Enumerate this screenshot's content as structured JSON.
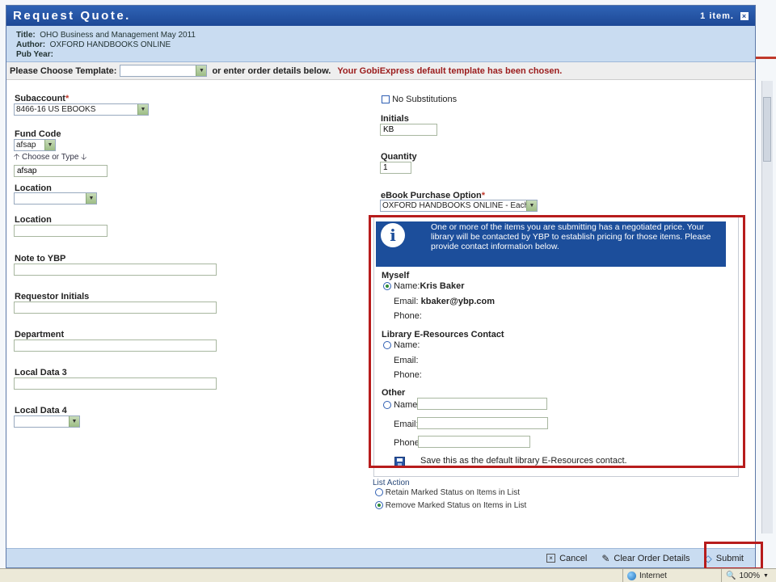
{
  "dialog": {
    "title": "Request Quote.",
    "item_count": "1 item.",
    "close_glyph": "×"
  },
  "info": {
    "title_label": "Title:",
    "title_value": "OHO Business and Management May 2011",
    "author_label": "Author:",
    "author_value": "OXFORD HANDBOOKS ONLINE",
    "pubyear_label": "Pub Year:"
  },
  "template": {
    "label": "Please Choose Template:",
    "selected": "",
    "or_text": "or enter order details below.",
    "message": "Your GobiExpress default template has been chosen."
  },
  "left": {
    "subaccount_label": "Subaccount",
    "subaccount_value": "8466-16 US EBOOKS",
    "fund_code_label": "Fund Code",
    "fund_code_select": "afsap",
    "choose_or_type": "Choose or Type",
    "fund_code_input": "afsap",
    "location1_label": "Location",
    "location1_value": "",
    "location2_label": "Location",
    "location2_value": "",
    "note_label": "Note to YBP",
    "requestor_label": "Requestor Initials",
    "department_label": "Department",
    "local3_label": "Local Data 3",
    "local4_label": "Local Data 4",
    "local4_value": ""
  },
  "right": {
    "no_subs_label": "No Substitutions",
    "initials_label": "Initials",
    "initials_value": "KB",
    "quantity_label": "Quantity",
    "quantity_value": "1",
    "ebook_label": "eBook Purchase Option",
    "ebook_value": "OXFORD HANDBOOKS ONLINE - Each"
  },
  "contact": {
    "notice": "One or more of the items you are submitting has a negotiated price. Your library will be contacted by YBP to establish pricing for those items. Please provide contact information below.",
    "notice_icon": "i",
    "myself_heading": "Myself",
    "name_label": "Name:",
    "myself_name": "Kris Baker",
    "email_label": "Email:",
    "myself_email": "kbaker@ybp.com",
    "phone_label": "Phone:",
    "library_heading": "Library E-Resources Contact",
    "other_heading": "Other",
    "other_phone_label": "Phone",
    "save_default": "Save this as the default library E-Resources contact."
  },
  "list_action": {
    "label": "List Action",
    "retain": "Retain Marked Status on Items in List",
    "remove": "Remove Marked Status on Items in List"
  },
  "footer": {
    "cancel": "Cancel",
    "clear": "Clear Order Details",
    "submit": "Submit"
  },
  "statusbar": {
    "zone": "Internet",
    "zoom": "100%"
  }
}
